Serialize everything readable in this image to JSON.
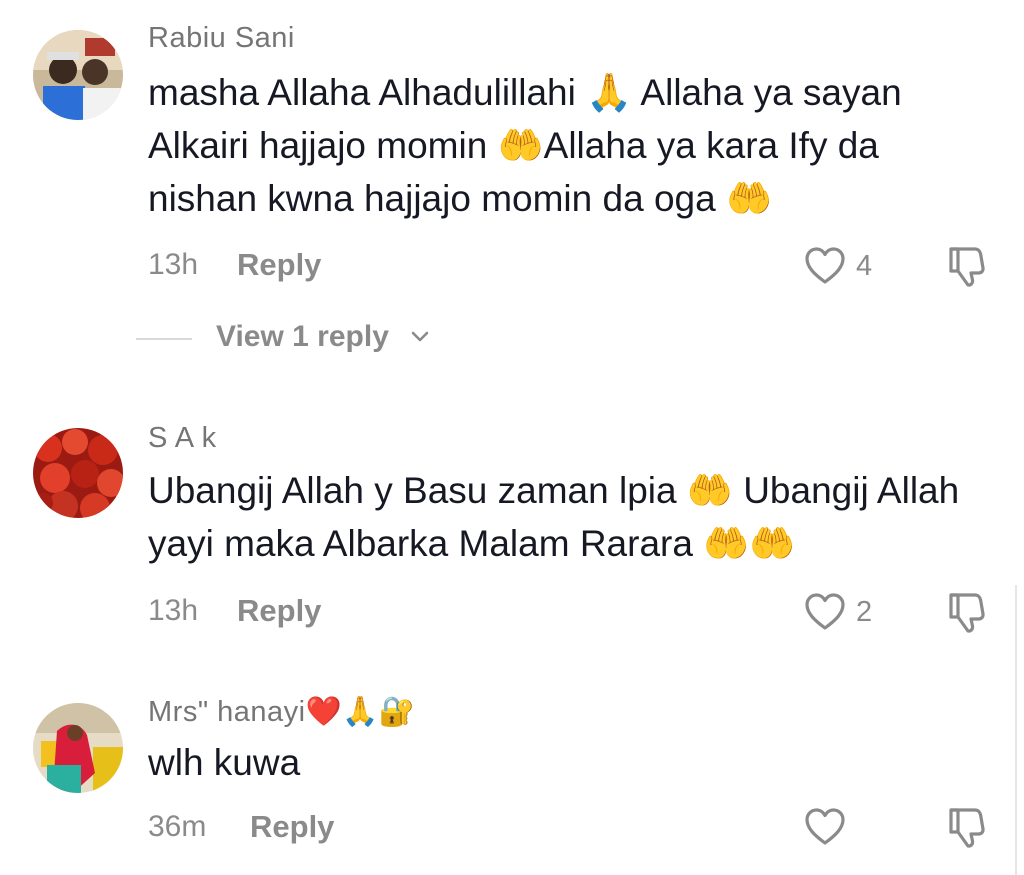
{
  "comments": [
    {
      "username": "Rabiu Sani",
      "text": "masha Allaha Alhadulillahi 🙏 Allaha ya sayan Alkairi hajjajo momin 🤲Allaha ya kara Ify da nishan kwna hajjajo momin da oga 🤲",
      "time": "13h",
      "reply_label": "Reply",
      "like_count": "4",
      "view_replies": "View 1 reply"
    },
    {
      "username": "S A k",
      "text": "Ubangij Allah y Basu zaman lpia 🤲 Ubangij Allah yayi maka Albarka Malam Rarara 🤲🤲",
      "time": "13h",
      "reply_label": "Reply",
      "like_count": "2"
    },
    {
      "username": "Mrs\" hanayi❤️🙏🔐",
      "text": "wlh kuwa",
      "time": "36m",
      "reply_label": "Reply",
      "like_count": ""
    }
  ],
  "icons": {
    "like": "heart-outline-icon",
    "dislike": "thumbs-down-outline-icon",
    "chevron": "chevron-down-icon"
  },
  "colors": {
    "text": "#161823",
    "secondary": "#8a8a8a",
    "username": "#757575",
    "background": "#ffffff"
  }
}
